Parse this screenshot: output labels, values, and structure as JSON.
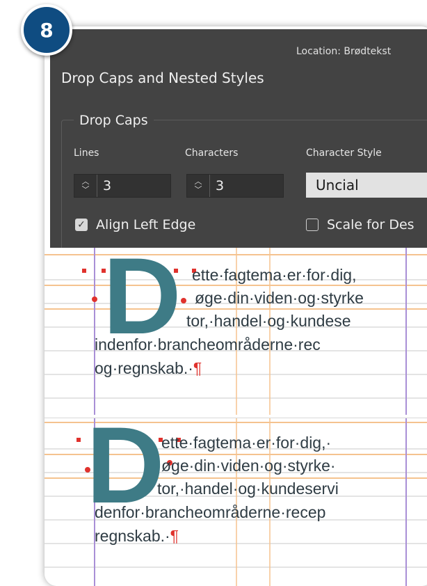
{
  "badge": {
    "number": "8"
  },
  "dialog": {
    "location_label": "Location: Brødtekst",
    "title": "Drop Caps and Nested Styles",
    "drop_caps_group": "Drop Caps",
    "lines_label": "Lines",
    "characters_label": "Characters",
    "character_style_label": "Character Style",
    "lines_value": "3",
    "characters_value": "3",
    "character_style_value": "Uncial",
    "align_left_edge_label": "Align Left Edge",
    "align_left_edge_checked": true,
    "scale_for_descenders_label": "Scale for Des",
    "scale_for_descenders_checked": false
  },
  "preview_top": {
    "drop_cap": "D",
    "line1": "ette·fagtema·er·for·dig,",
    "line2": "øge·din·viden·og·styrke",
    "line3": "tor,·handel·og·kundese",
    "line4": "indenfor·brancheområderne·rec",
    "line5": "og·regnskab.·",
    "pilcrow": "¶"
  },
  "preview_bottom": {
    "drop_cap": "D",
    "line1": "ette·fagtema·er·for·dig,·",
    "line2": "øge·din·viden·og·styrke·",
    "line3": "tor,·handel·og·kundeservi",
    "line4": "denfor·brancheområderne·recep",
    "line5": "regnskab.·",
    "pilcrow": "¶"
  },
  "colors": {
    "badge": "#0f4c81",
    "dialog_bg": "#434343",
    "drop_cap": "#3e7b86",
    "guide_orange": "#f5c38f",
    "guide_purple": "#a98fd6",
    "baseline_grid": "#c9c9c9",
    "marker_red": "#e0322d"
  }
}
